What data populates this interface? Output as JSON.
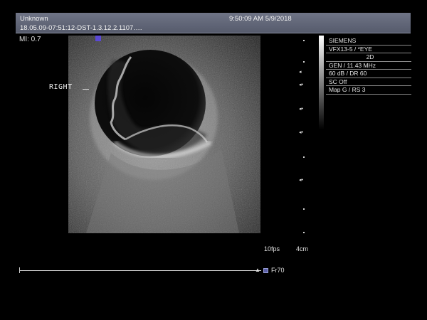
{
  "header": {
    "patient_name": "Unknown",
    "datetime": "9:50:09 AM 5/9/2018",
    "exam_id": "18.05.09-07:51:12-DST-1.3.12.2.1107…."
  },
  "mi_label": "MI: 0.7",
  "orientation": {
    "side_label": "RIGHT"
  },
  "params": {
    "manufacturer": "SIEMENS",
    "transducer": "VFX13-5 / *EYE",
    "mode": "2D",
    "frequency": "GEN / 11.43 MHz",
    "gain": "60 dB / DR 60",
    "sc": "SC Off",
    "map": "Map G / RS 3"
  },
  "footer": {
    "fps": "10fps",
    "depth": "4cm",
    "frame": "Fr70"
  },
  "colors": {
    "header_bg": "#62677a",
    "orientation_marker": "#5b49d6"
  },
  "icons": {
    "orientation_marker": "square-marker",
    "depth_focus": "triangle-left-arrow",
    "cine_end": "triangle-up-arrow",
    "frame": "square-frame-icon"
  }
}
